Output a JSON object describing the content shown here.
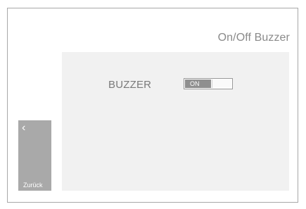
{
  "header": {
    "title": "On/Off Buzzer"
  },
  "settings": {
    "buzzer_label": "BUZZER",
    "buzzer_toggle_state": "ON"
  },
  "navigation": {
    "back_icon": "chevron-left-icon",
    "back_glyph": "‹",
    "back_label": "Zurück"
  },
  "colors": {
    "panel": "#f1f1f1",
    "toggle_on": "#8f8f8f",
    "back_button": "#a9a9a9",
    "text_gray": "#8a8a8a"
  }
}
